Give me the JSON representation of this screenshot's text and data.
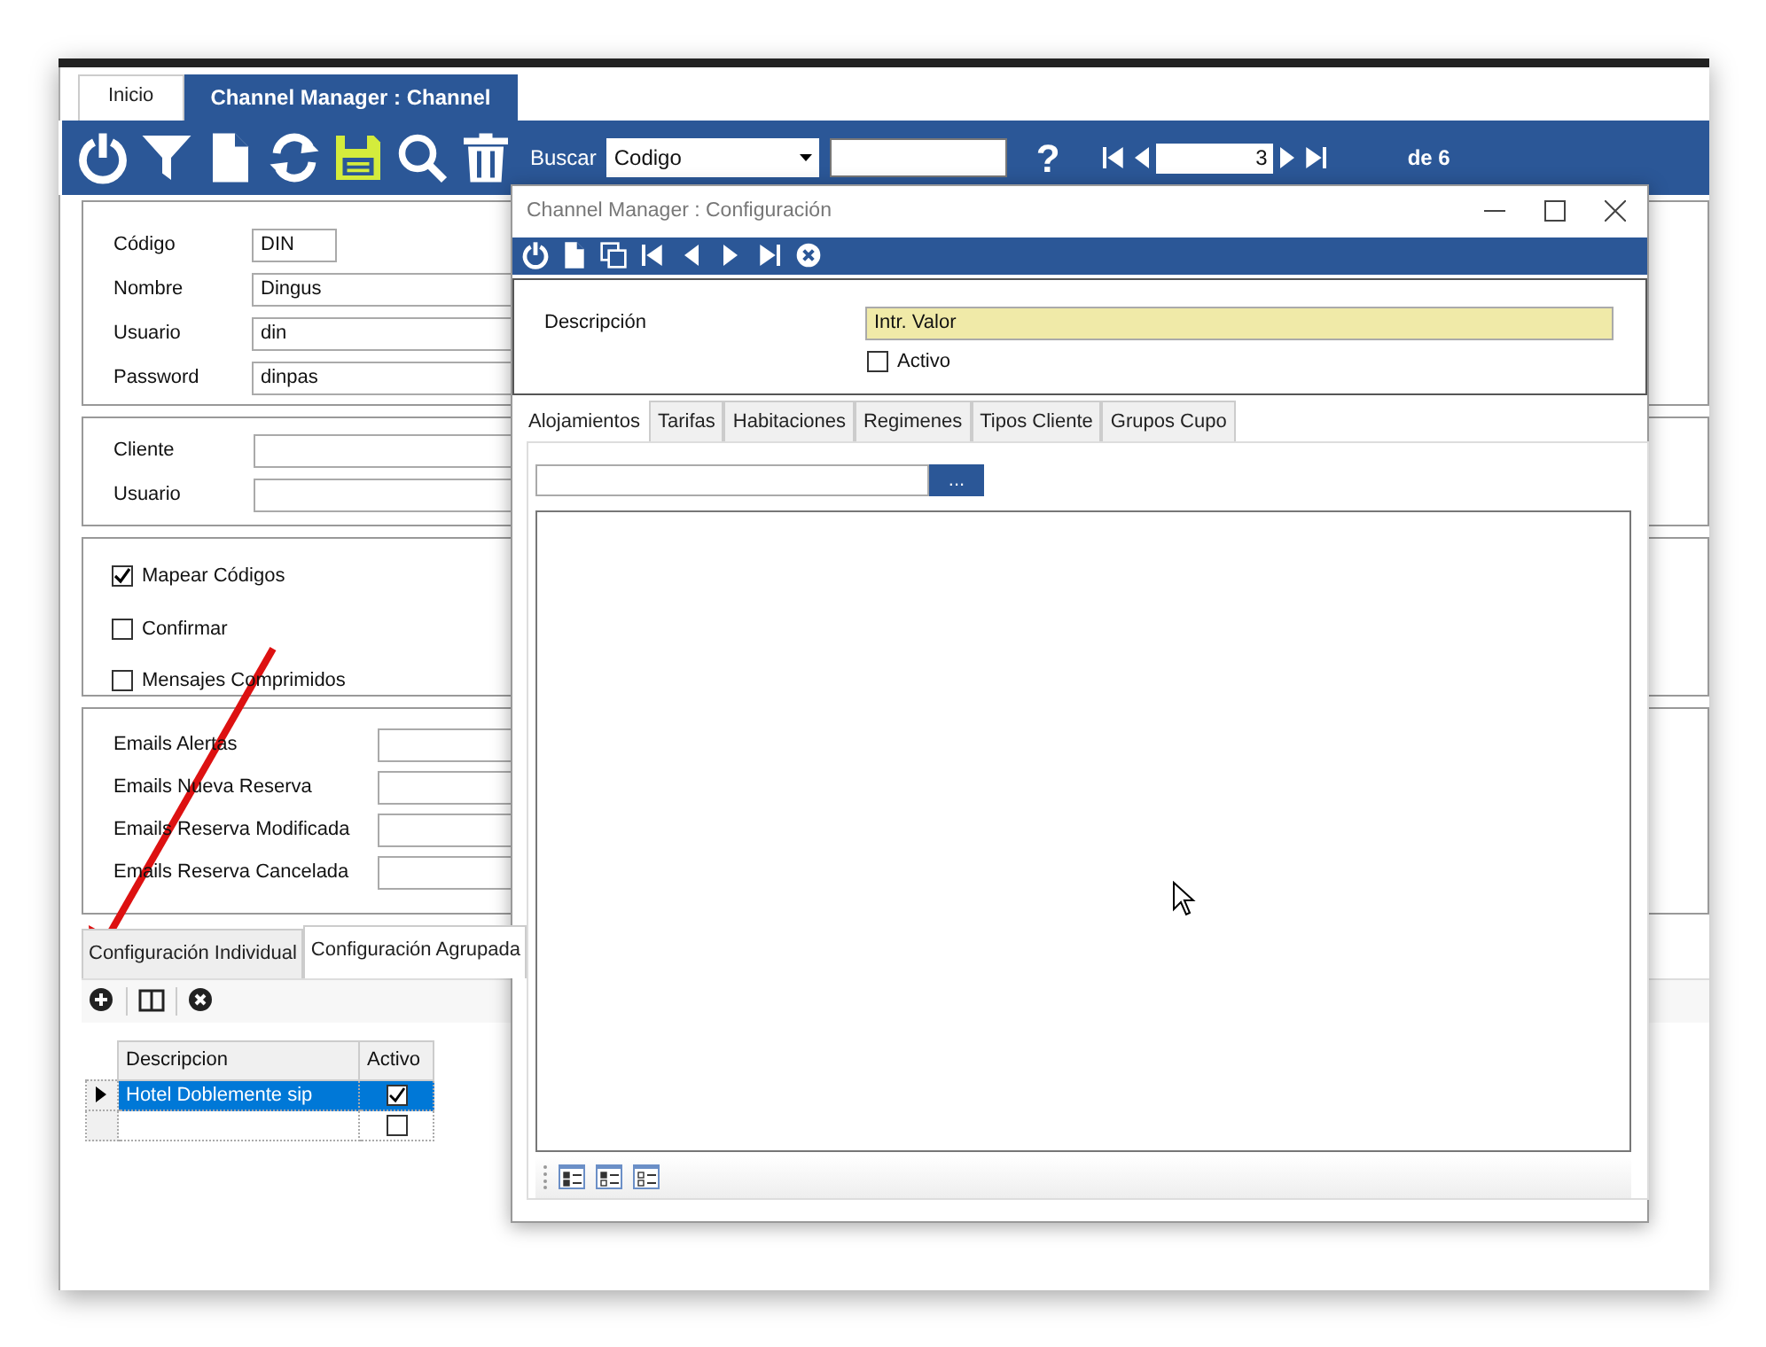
{
  "main_tabs": [
    {
      "label": "Inicio",
      "selected": false
    },
    {
      "label": "Channel Manager : Channel",
      "selected": true
    }
  ],
  "toolbar": {
    "search_label": "Buscar",
    "search_by": "Codigo",
    "record": "3",
    "help": "?",
    "total": "de 6"
  },
  "general": [
    {
      "label": "Código",
      "value": "DIN",
      "kind": "short"
    },
    {
      "label": "Nombre",
      "value": "Dingus",
      "kind": "long"
    },
    {
      "label": "Usuario",
      "value": "din",
      "kind": "long"
    },
    {
      "label": "Password",
      "value": "dinpas",
      "kind": "long"
    }
  ],
  "client": [
    {
      "label": "Cliente"
    },
    {
      "label": "Usuario"
    }
  ],
  "options": [
    {
      "label": "Mapear Códigos",
      "checked": true
    },
    {
      "label": "Confirmar",
      "checked": false
    },
    {
      "label": "Mensajes Comprimidos",
      "checked": false
    }
  ],
  "emails": [
    {
      "label": "Emails Alertas"
    },
    {
      "label": "Emails Nueva Reserva"
    },
    {
      "label": "Emails Reserva Modificada"
    },
    {
      "label": "Emails Reserva Cancelada"
    }
  ],
  "sub_tabs": [
    {
      "label": "Configuración Individual",
      "selected": false
    },
    {
      "label": "Configuración Agrupada",
      "selected": true
    }
  ],
  "grid": {
    "columns": [
      "Descripcion",
      "Activo"
    ],
    "rows": [
      {
        "descripcion": "Hotel Doblemente sip",
        "activo": true,
        "selected": true
      },
      {
        "activo": false,
        "selected": false
      }
    ]
  },
  "dialog": {
    "title": "Channel Manager : Configuración",
    "description_label": "Descripción",
    "description_value": "Intr. Valor",
    "activo": {
      "label": "Activo",
      "checked": false
    },
    "tabs": [
      {
        "label": "Alojamientos",
        "selected": true
      },
      {
        "label": "Tarifas",
        "selected": false
      },
      {
        "label": "Habitaciones",
        "selected": false
      },
      {
        "label": "Regimenes",
        "selected": false
      },
      {
        "label": "Tipos Cliente",
        "selected": false
      },
      {
        "label": "Grupos Cupo",
        "selected": false
      }
    ],
    "browse_button": "..."
  }
}
